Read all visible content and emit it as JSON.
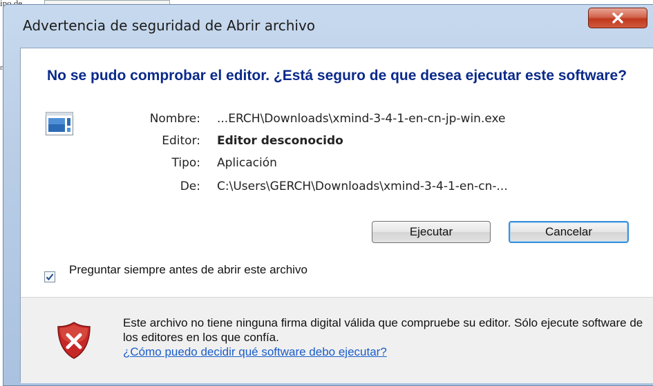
{
  "background": {
    "text_fragment_1": "ipo de",
    "text_fragment_2": "ne"
  },
  "dialog": {
    "title": "Advertencia de seguridad de Abrir archivo",
    "heading": "No se pudo comprobar el editor. ¿Está seguro de que desea ejecutar este software?",
    "fields": [
      {
        "label": "Nombre:",
        "value": "...ERCH\\Downloads\\xmind-3-4-1-en-cn-jp-win.exe"
      },
      {
        "label": "Editor:",
        "value": "Editor desconocido"
      },
      {
        "label": "Tipo:",
        "value": "Aplicación"
      },
      {
        "label": "De:",
        "value": "C:\\Users\\GERCH\\Downloads\\xmind-3-4-1-en-cn-..."
      }
    ],
    "buttons": {
      "run": "Ejecutar",
      "cancel": "Cancelar"
    },
    "checkbox": {
      "label": "Preguntar siempre antes de abrir este archivo",
      "checked": true
    },
    "footer": {
      "text": "Este archivo no tiene ninguna firma digital válida que compruebe su editor. Sólo ejecute software de los editores en los que confía.",
      "link": "¿Cómo puedo decidir qué software debo ejecutar?"
    }
  },
  "colors": {
    "heading": "#0a2a8a",
    "link": "#1a5dc8",
    "close_button": "#c0391f",
    "shield": "#c62828"
  },
  "icons": {
    "close": "close-icon",
    "application": "application-icon",
    "warning_shield": "shield-error-icon",
    "checkbox_check": "checkmark-icon"
  }
}
